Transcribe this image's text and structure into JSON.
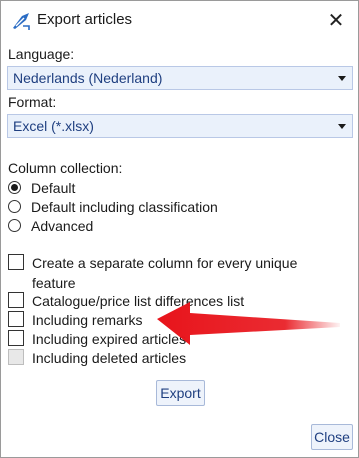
{
  "window": {
    "title": "Export articles",
    "close_glyph": "✕"
  },
  "language": {
    "label": "Language:",
    "value": "Nederlands (Nederland)"
  },
  "format": {
    "label": "Format:",
    "value": "Excel (*.xlsx)"
  },
  "column_collection": {
    "label": "Column collection:",
    "options": [
      {
        "label": "Default",
        "selected": true
      },
      {
        "label": "Default including classification",
        "selected": false
      },
      {
        "label": "Advanced",
        "selected": false
      }
    ]
  },
  "checkboxes": [
    {
      "label": "Create a separate column for every unique feature",
      "checked": false,
      "enabled": true
    },
    {
      "label": "Catalogue/price list differences list",
      "checked": false,
      "enabled": true
    },
    {
      "label": "Including remarks",
      "checked": false,
      "enabled": true
    },
    {
      "label": "Including expired articles",
      "checked": false,
      "enabled": true
    },
    {
      "label": "Including deleted articles",
      "checked": false,
      "enabled": false
    }
  ],
  "buttons": {
    "export": "Export",
    "close": "Close"
  },
  "colors": {
    "accent_text": "#1f3f80",
    "combo_bg": "#eaf1fb",
    "annotation_arrow": "#e8141b"
  }
}
